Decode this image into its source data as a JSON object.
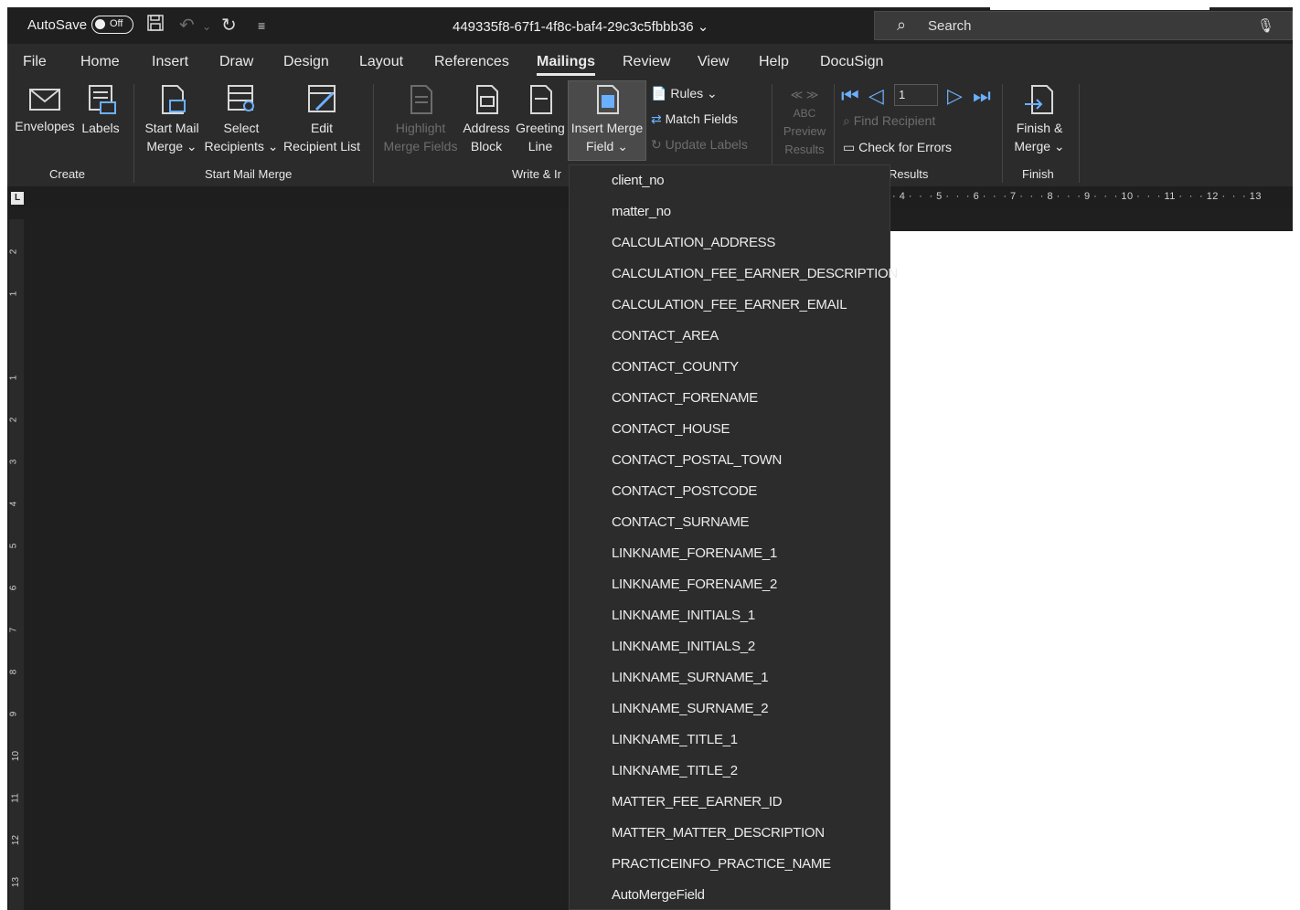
{
  "titlebar": {
    "autosave_label": "AutoSave",
    "autosave_state": "Off",
    "doc_title": "449335f8-67f1-4f8c-baf4-29c3c5fbbb36",
    "search_label": "Search"
  },
  "menu": {
    "tabs": [
      "File",
      "Home",
      "Insert",
      "Draw",
      "Design",
      "Layout",
      "References",
      "Mailings",
      "Review",
      "View",
      "Help",
      "DocuSign"
    ],
    "active": "Mailings"
  },
  "ribbon": {
    "create": {
      "envelopes": "Envelopes",
      "labels": "Labels",
      "group": "Create"
    },
    "start_mail_merge": {
      "start_l1": "Start Mail",
      "start_l2": "Merge",
      "select_l1": "Select",
      "select_l2": "Recipients",
      "edit_l1": "Edit",
      "edit_l2": "Recipient List",
      "group": "Start Mail Merge"
    },
    "write_insert": {
      "highlight_l1": "Highlight",
      "highlight_l2": "Merge Fields",
      "address_l1": "Address",
      "address_l2": "Block",
      "greeting_l1": "Greeting",
      "greeting_l2": "Line",
      "insert_l1": "Insert Merge",
      "insert_l2": "Field",
      "rules": "Rules",
      "match_fields": "Match Fields",
      "update_labels": "Update Labels",
      "group": "Write & Ir"
    },
    "preview": {
      "abc": "ABC",
      "preview_l1": "Preview",
      "preview_l2": "Results",
      "record": "1",
      "find_recipient": "Find Recipient",
      "check_errors": "Check for Errors",
      "group": "Results"
    },
    "finish": {
      "finish_l1": "Finish &",
      "finish_l2": "Merge",
      "group": "Finish"
    }
  },
  "ruler": {
    "horizontal": "· 4 ·  ·  · 5 ·  ·  · 6 ·  ·  · 7 ·  ·  · 8 ·  ·  · 9 ·  ·  · 10 ·  ·  · 11 ·  ·  · 12 ·  ·  · 13",
    "vertical": [
      "2",
      "1",
      "1",
      "2",
      "3",
      "4",
      "5",
      "6",
      "7",
      "8",
      "9",
      "10",
      "11",
      "12",
      "13"
    ]
  },
  "merge_fields": [
    "client_no",
    "matter_no",
    "CALCULATION_ADDRESS",
    "CALCULATION_FEE_EARNER_DESCRIPTION",
    "CALCULATION_FEE_EARNER_EMAIL",
    "CONTACT_AREA",
    "CONTACT_COUNTY",
    "CONTACT_FORENAME",
    "CONTACT_HOUSE",
    "CONTACT_POSTAL_TOWN",
    "CONTACT_POSTCODE",
    "CONTACT_SURNAME",
    "LINKNAME_FORENAME_1",
    "LINKNAME_FORENAME_2",
    "LINKNAME_INITIALS_1",
    "LINKNAME_INITIALS_2",
    "LINKNAME_SURNAME_1",
    "LINKNAME_SURNAME_2",
    "LINKNAME_TITLE_1",
    "LINKNAME_TITLE_2",
    "MATTER_FEE_EARNER_ID",
    "MATTER_MATTER_DESCRIPTION",
    "PRACTICEINFO_PRACTICE_NAME",
    "AutoMergeField"
  ]
}
